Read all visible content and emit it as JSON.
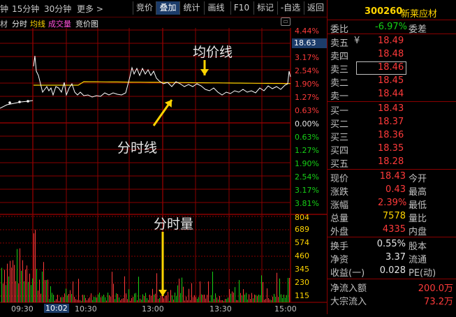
{
  "toolbar": {
    "period_left": "钟",
    "period_15": "15分钟",
    "period_30": "30分钟",
    "more": "更多 >",
    "buttons": [
      "竞价",
      "叠加",
      "统计",
      "画线",
      "F10",
      "标记",
      "-自选",
      "返回"
    ],
    "active_button": "叠加"
  },
  "subtabs": {
    "first": "材",
    "items": [
      "分时",
      "均线",
      "成交量",
      "竞价图"
    ]
  },
  "price_axis": {
    "right_labels": [
      "4.44%",
      "3.81%",
      "3.17%",
      "2.54%",
      "1.90%",
      "1.27%",
      "0.63%",
      "0.00%",
      "0.63%",
      "1.27%",
      "1.90%",
      "2.54%",
      "3.17%",
      "3.81%"
    ],
    "current_price_tag": "18.63"
  },
  "volume_axis": {
    "labels": [
      "804",
      "689",
      "574",
      "460",
      "345",
      "230",
      "115"
    ]
  },
  "time_axis": {
    "labels": [
      "09:30",
      "10:02",
      "10:30",
      "13:00",
      "13:30",
      "15:00"
    ]
  },
  "annotations": {
    "avg_line": "均价线",
    "time_line": "分时线",
    "time_volume": "分时量"
  },
  "stock": {
    "code": "300260",
    "name": "新莱应材",
    "weibi_label": "委比",
    "weibi_value": "-6.97%",
    "weicha_label": "委差"
  },
  "asks": [
    {
      "label": "卖五",
      "price": "18.49",
      "tag": "¥"
    },
    {
      "label": "卖四",
      "price": "18.48"
    },
    {
      "label": "卖三",
      "price": "18.46"
    },
    {
      "label": "卖二",
      "price": "18.45"
    },
    {
      "label": "卖一",
      "price": "18.44"
    }
  ],
  "bids": [
    {
      "label": "买一",
      "price": "18.43"
    },
    {
      "label": "买二",
      "price": "18.37"
    },
    {
      "label": "买三",
      "price": "18.36"
    },
    {
      "label": "买四",
      "price": "18.35"
    },
    {
      "label": "买五",
      "price": "18.28"
    }
  ],
  "quote": [
    {
      "label": "现价",
      "value": "18.43",
      "label2": "今开"
    },
    {
      "label": "涨跌",
      "value": "0.43",
      "label2": "最高"
    },
    {
      "label": "涨幅",
      "value": "2.39%",
      "label2": "最低"
    },
    {
      "label": "总量",
      "value": "7578",
      "label2": "量比"
    },
    {
      "label": "外盘",
      "value": "4335",
      "label2": "内盘"
    }
  ],
  "stats": [
    {
      "label": "换手",
      "value": "0.55%",
      "label2": "股本"
    },
    {
      "label": "净资",
      "value": "3.37",
      "label2": "流通"
    },
    {
      "label": "收益(一)",
      "value": "0.028",
      "label2": "PE(动)"
    }
  ],
  "flows": [
    {
      "label": "净流入额",
      "value": "200.0万"
    },
    {
      "label": "大宗流入",
      "value": "73.2万"
    }
  ],
  "colors": {
    "up": "#ff3a3a",
    "down": "#16d016",
    "avg_line": "#ffd400",
    "price_line": "#ffffff",
    "grid": "#8a0000",
    "accent_code": "#ffd400"
  }
}
